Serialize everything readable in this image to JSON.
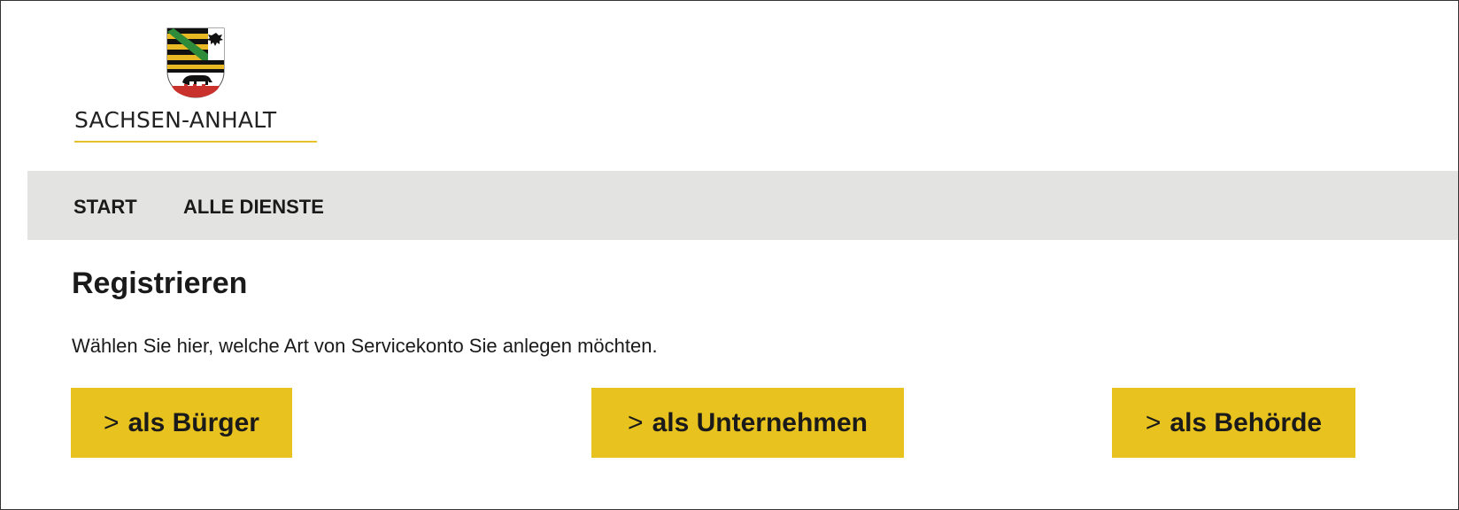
{
  "header": {
    "logo_text": "SACHSEN-ANHALT",
    "coat_of_arms_icon": "coat-of-arms-icon"
  },
  "nav": {
    "items": [
      {
        "label": "START"
      },
      {
        "label": "ALLE DIENSTE"
      }
    ]
  },
  "main": {
    "title": "Registrieren",
    "intro": "Wählen Sie hier, welche Art von Servicekonto Sie anlegen möchten.",
    "buttons": [
      {
        "chevron": ">",
        "label": "als Bürger"
      },
      {
        "chevron": ">",
        "label": "als Unternehmen"
      },
      {
        "chevron": ">",
        "label": "als Behörde"
      }
    ]
  },
  "colors": {
    "accent": "#e8c21e",
    "nav_background": "#e3e3e2",
    "text": "#1a1a1a"
  }
}
